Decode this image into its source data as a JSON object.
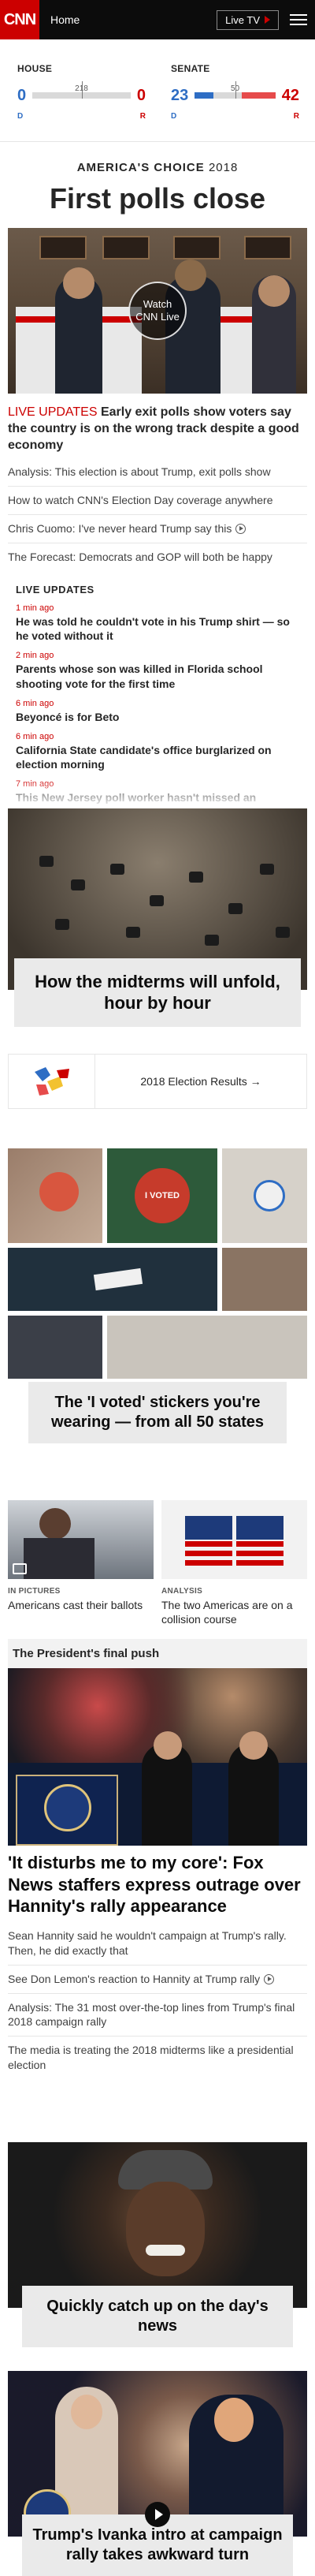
{
  "header": {
    "logo": "CNN",
    "home_label": "Home",
    "live_tv_label": "Live TV"
  },
  "scoreboard": {
    "house": {
      "title": "HOUSE",
      "dem": "0",
      "rep": "0",
      "threshold": "218",
      "dem_label": "D",
      "rep_label": "R",
      "dem_share": 0,
      "rep_share": 0
    },
    "senate": {
      "title": "SENATE",
      "dem": "23",
      "rep": "42",
      "threshold": "50",
      "dem_label": "D",
      "rep_label": "R",
      "dem_share": 0.23,
      "rep_share": 0.42
    }
  },
  "banner": {
    "choice": "AMERICA'S CHOICE",
    "year": "2018",
    "headline": "First polls close"
  },
  "hero": {
    "play_label_1": "Watch",
    "play_label_2": "CNN Live"
  },
  "lead": {
    "kicker": "LIVE UPDATES",
    "text": "Early exit polls show voters say the country is on the wrong track despite a good economy"
  },
  "links": [
    {
      "text": "Analysis: This election is about Trump, exit polls show",
      "video": false
    },
    {
      "text": "How to watch CNN's Election Day coverage anywhere",
      "video": false
    },
    {
      "text": "Chris Cuomo: I've never heard Trump say this",
      "video": true
    },
    {
      "text": "The Forecast: Democrats and GOP will both be happy",
      "video": false
    }
  ],
  "live_updates": {
    "title": "LIVE UPDATES",
    "items": [
      {
        "time": "1 min ago",
        "text": "He was told he couldn't vote in his Trump shirt — so he voted without it"
      },
      {
        "time": "2 min ago",
        "text": "Parents whose son was killed in Florida school shooting vote for the first time"
      },
      {
        "time": "6 min ago",
        "text": "Beyoncé is for Beto"
      },
      {
        "time": "6 min ago",
        "text": "California State candidate's office burglarized on election morning"
      },
      {
        "time": "7 min ago",
        "text": "This New Jersey poll worker hasn't missed an"
      }
    ]
  },
  "midterms_card": {
    "caption": "How the midterms will unfold, hour by hour"
  },
  "promo": {
    "text": "2018 Election Results →"
  },
  "stickers": {
    "caption": "The 'I voted' stickers you're wearing — from all 50 states",
    "sticker_text": "I VOTED"
  },
  "twoup": [
    {
      "label": "IN PICTURES",
      "title": "Americans cast their ballots"
    },
    {
      "label": "ANALYSIS",
      "title": "The two Americas are on a collision course"
    }
  ],
  "president_section": {
    "title": "The President's final push",
    "story_title": "'It disturbs me to my core': Fox News staffers express outrage over Hannity's rally appearance",
    "links": [
      {
        "text": "Sean Hannity said he wouldn't campaign at Trump's rally. Then, he did exactly that",
        "video": false
      },
      {
        "text": "See Don Lemon's reaction to Hannity at Trump rally",
        "video": true
      },
      {
        "text": "Analysis: The 31 most over-the-top lines from Trump's final 2018 campaign rally",
        "video": false
      },
      {
        "text": "The media is treating the 2018 midterms like a presidential election",
        "video": false
      }
    ]
  },
  "catchup": {
    "caption": "Quickly catch up on the day's news"
  },
  "ivanka": {
    "caption": "Trump's Ivanka intro at campaign rally takes awkward turn"
  },
  "colors": {
    "brand": "#cc0000",
    "dem": "#2e6dc4",
    "rep": "#cc0000"
  }
}
